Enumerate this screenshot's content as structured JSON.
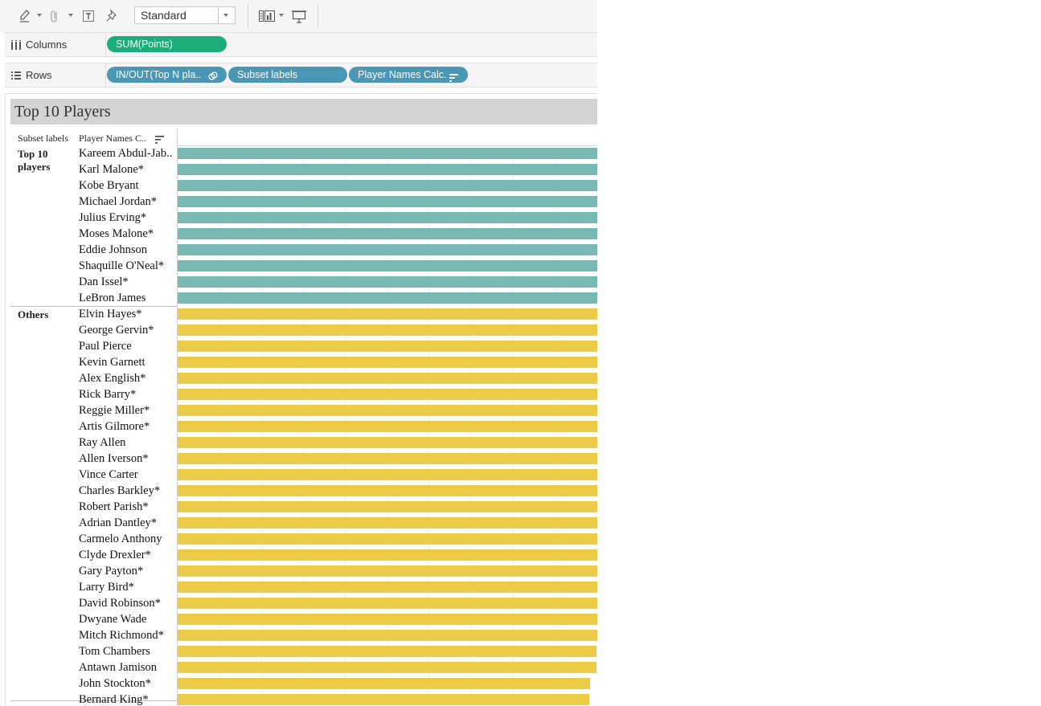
{
  "toolbar": {
    "fit_value": "Standard",
    "icons": [
      "highlighter-icon",
      "paperclip-icon",
      "text-label-icon",
      "pin-icon",
      "show-me-icon",
      "presentation-icon"
    ]
  },
  "shelves": {
    "columns": {
      "label": "Columns",
      "icon": "columns-icon",
      "pills": [
        "SUM(Points)"
      ]
    },
    "rows": {
      "label": "Rows",
      "icon": "rows-icon",
      "pills": [
        "IN/OUT(Top N pla..",
        "Subset labels",
        "Player Names Calc."
      ]
    }
  },
  "view": {
    "title": "Top 10 Players",
    "headers": {
      "subset": "Subset labels",
      "player": "Player Names C.."
    },
    "groups": [
      {
        "label_line1": "Top 10",
        "label_line2": "players"
      },
      {
        "label_line1": "Others",
        "label_line2": ""
      }
    ]
  },
  "colors": {
    "in_set": "#79b8b3",
    "others": "#eccb48",
    "pill_green": "#1aae7a",
    "pill_blue": "#4a96b5"
  },
  "chart_data": {
    "type": "bar",
    "orientation": "horizontal",
    "measure": "SUM(Points)",
    "series": [
      {
        "group": "Top 10 players",
        "color": "#79b8b3",
        "categories": [
          "Kareem Abdul-Jab..",
          "Karl Malone*",
          "Kobe Bryant",
          "Michael Jordan*",
          "Julius Erving*",
          "Moses Malone*",
          "Eddie Johnson",
          "Shaquille O'Neal*",
          "Dan Issel*",
          "LeBron James"
        ],
        "values": [
          1.0,
          1.0,
          1.0,
          1.0,
          1.0,
          1.0,
          1.0,
          1.0,
          1.0,
          1.0
        ]
      },
      {
        "group": "Others",
        "color": "#eccb48",
        "categories": [
          "Elvin Hayes*",
          "George Gervin*",
          "Paul Pierce",
          "Kevin Garnett",
          "Alex English*",
          "Rick Barry*",
          "Reggie Miller*",
          "Artis Gilmore*",
          "Ray Allen",
          "Allen Iverson*",
          "Vince Carter",
          "Charles Barkley*",
          "Robert Parish*",
          "Adrian Dantley*",
          "Carmelo Anthony",
          "Clyde Drexler*",
          "Gary Payton*",
          "Larry Bird*",
          "David Robinson*",
          "Dwyane Wade",
          "Mitch Richmond*",
          "Tom Chambers",
          "Antawn Jamison",
          "John Stockton*",
          "Bernard King*"
        ],
        "values": [
          1.0,
          1.0,
          1.0,
          1.0,
          1.0,
          1.0,
          1.0,
          1.0,
          1.0,
          1.0,
          1.0,
          1.0,
          1.0,
          1.0,
          1.0,
          1.0,
          1.0,
          1.0,
          1.0,
          1.0,
          1.0,
          0.998,
          0.998,
          0.982,
          0.98
        ]
      }
    ],
    "value_note_unit": "fraction of visible axis width (axis clipped)",
    "grid": true,
    "xlabel": "",
    "ylabel": ""
  }
}
